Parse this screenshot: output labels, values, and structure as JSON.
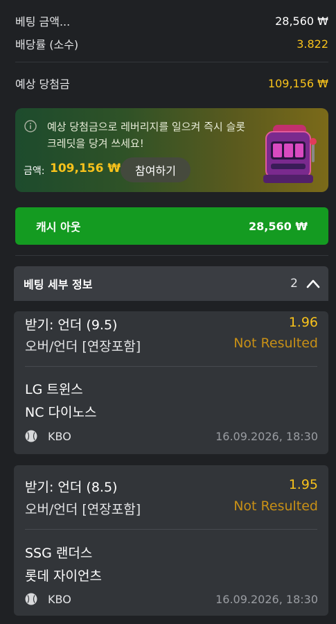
{
  "summary": {
    "bet_amount_label": "베팅 금액...",
    "bet_amount_value": "28,560 ₩",
    "odds_label": "배당률 (소수)",
    "odds_value": "3.822",
    "potential_win_label": "예상 당첨금",
    "potential_win_value": "109,156 ₩"
  },
  "promo": {
    "text": "예상 당첨금으로 레버리지를 일으켜 즉시 슬롯 크레딧을 당겨 쓰세요!",
    "amount_label": "금액:",
    "amount_value": "109,156 ₩",
    "join_label": "참여하기",
    "icons": [
      "info-icon",
      "slot-machine-icon"
    ]
  },
  "cashout": {
    "label": "캐시 아웃",
    "value": "28,560 ₩"
  },
  "details": {
    "title": "베팅 세부 정보",
    "count": "2",
    "toggle_icon": "chevron-up-icon",
    "bets": [
      {
        "pick": "받기: 언더 (9.5)",
        "odds": "1.96",
        "market": "오버/언더 [연장포함]",
        "status": "Not Resulted",
        "home": "LG 트윈스",
        "away": "NC 다이노스",
        "league": "KBO",
        "date": "16.09.2026, 18:30"
      },
      {
        "pick": "받기: 언더 (8.5)",
        "odds": "1.95",
        "market": "오버/언더 [연장포함]",
        "status": "Not Resulted",
        "home": "SSG 랜더스",
        "away": "롯데 자이언츠",
        "league": "KBO",
        "date": "16.09.2026, 18:30"
      }
    ]
  },
  "colors": {
    "accent_yellow": "#f8c21b",
    "cashout_green": "#149b21",
    "status_orange": "#c89016",
    "background": "#1f2124"
  }
}
